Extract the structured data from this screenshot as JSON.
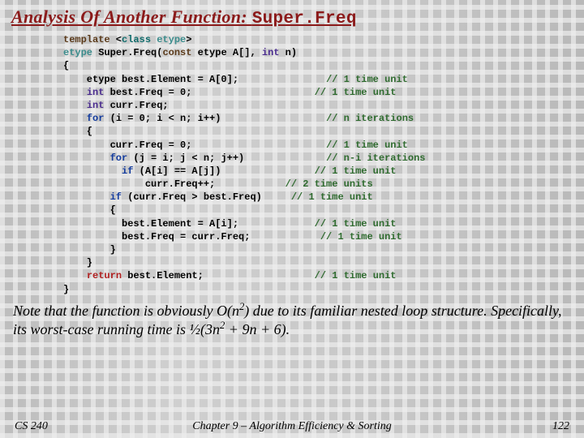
{
  "title_prefix": "Analysis Of Another Function: ",
  "title_mono": "Super.Freq",
  "code": {
    "l01a": "template",
    "l01b": " <",
    "l01c": "class",
    "l01d": " etype",
    "l01e": ">",
    "l02a": "etype",
    "l02b": " Super.Freq(",
    "l02c": "const",
    "l02d": " etype A[], ",
    "l02e": "int",
    "l02f": " n)",
    "l03": "{",
    "l04a": "    etype best.Element = A[0];",
    "l04c": "               // 1 time unit",
    "l05a": "    ",
    "l05b": "int",
    "l05c": " best.Freq = 0;",
    "l05d": "                     // 1 time unit",
    "l06a": "    ",
    "l06b": "int",
    "l06c": " curr.Freq;",
    "l07a": "    ",
    "l07b": "for",
    "l07c": " (i = 0; i < n; i++)",
    "l07d": "                  // n iterations",
    "l08": "    {",
    "l09a": "        curr.Freq = 0;",
    "l09c": "                       // 1 time unit",
    "l10a": "        ",
    "l10b": "for",
    "l10c": " (j = i; j < n; j++)",
    "l10d": "              // n-i iterations",
    "l11a": "          ",
    "l11b": "if",
    "l11c": " (A[i] == A[j])",
    "l11d": "                // 1 time unit",
    "l12a": "              curr.Freq++;",
    "l12c": "            // 2 time units",
    "l13a": "        ",
    "l13b": "if",
    "l13c": " (curr.Freq > best.Freq)",
    "l13d": "     // 1 time unit",
    "l14": "        {",
    "l15a": "          best.Element = A[i];",
    "l15c": "             // 1 time unit",
    "l16a": "          best.Freq = curr.Freq;",
    "l16c": "            // 1 time unit",
    "l17": "        }",
    "l18": "    }",
    "l19a": "    ",
    "l19b": "return",
    "l19c": " best.Element;",
    "l19d": "                   // 1 time unit",
    "l20": "}"
  },
  "note_parts": {
    "a": "Note that the function is obviously O(n",
    "b": ") due to its familiar nested loop structure.  Specifically, its worst-case running time is ½(3n",
    "c": " + 9n + 6)."
  },
  "footer": {
    "left": "CS 240",
    "center": "Chapter 9 – Algorithm Efficiency & Sorting",
    "right": "122"
  }
}
